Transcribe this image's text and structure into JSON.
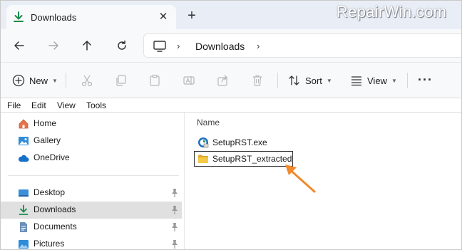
{
  "window": {
    "tab_title": "Downloads",
    "tab_close_icon": "close-icon",
    "new_tab_icon": "plus-icon",
    "watermark": "RepairWin.com"
  },
  "navigation": {
    "back_icon": "arrow-left-icon",
    "forward_icon": "arrow-right-icon",
    "up_icon": "arrow-up-icon",
    "refresh_icon": "refresh-icon",
    "address": {
      "root_icon": "computer-icon",
      "segment": "Downloads"
    }
  },
  "command_bar": {
    "new_label": "New",
    "sort_label": "Sort",
    "view_label": "View",
    "icons": [
      "cut-icon",
      "copy-icon",
      "paste-icon",
      "rename-icon",
      "share-icon",
      "delete-icon",
      "more-icon"
    ]
  },
  "menu": {
    "items": [
      "File",
      "Edit",
      "View",
      "Tools"
    ]
  },
  "nav_pane": {
    "items": [
      {
        "label": "Home",
        "icon": "home-icon",
        "pinned": false,
        "selected": false
      },
      {
        "label": "Gallery",
        "icon": "gallery-icon",
        "pinned": false,
        "selected": false
      },
      {
        "label": "OneDrive",
        "icon": "cloud-icon",
        "pinned": false,
        "selected": false
      },
      {
        "label": "Desktop",
        "icon": "desktop-icon",
        "pinned": true,
        "selected": false
      },
      {
        "label": "Downloads",
        "icon": "download-icon",
        "pinned": true,
        "selected": true
      },
      {
        "label": "Documents",
        "icon": "document-icon",
        "pinned": true,
        "selected": false
      },
      {
        "label": "Pictures",
        "icon": "pictures-icon",
        "pinned": true,
        "selected": false
      }
    ]
  },
  "file_list": {
    "column_name": "Name",
    "files": [
      {
        "name": "SetupRST.exe",
        "icon": "installer-icon",
        "selected": false
      },
      {
        "name": "SetupRST_extracted",
        "icon": "folder-icon",
        "selected": true
      }
    ]
  },
  "colors": {
    "accent": "#0f7b3f",
    "folder": "#f3c13a",
    "annotation_arrow": "#f08a2c",
    "selection_bg": "#e0e0e0"
  }
}
